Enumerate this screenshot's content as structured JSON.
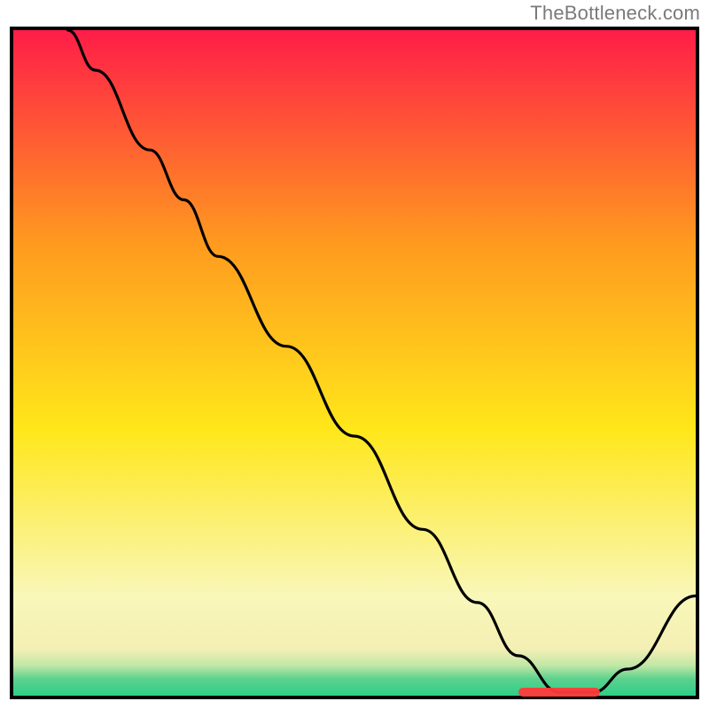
{
  "attribution": "TheBottleneck.com",
  "colors": {
    "gradient_top": "#ff1d48",
    "gradient_orange": "#ff9a1f",
    "gradient_yellow": "#ffe71a",
    "gradient_cream": "#f9f7b9",
    "gradient_low": "#f4efb4",
    "gradient_green1": "#bfe7a6",
    "gradient_green2": "#5bd18e",
    "gradient_green3": "#2ecf87",
    "border": "#000000",
    "curve": "#000000",
    "marker": "#ff3a3a"
  },
  "chart_data": {
    "type": "line",
    "title": "",
    "xlabel": "",
    "ylabel": "",
    "xlim": [
      0,
      100
    ],
    "ylim": [
      0,
      100
    ],
    "grid": false,
    "legend": false,
    "series": [
      {
        "name": "curve",
        "x": [
          8,
          12,
          20,
          25,
          30,
          40,
          50,
          60,
          68,
          74,
          80,
          85,
          90,
          100
        ],
        "y": [
          100,
          94,
          82,
          74.5,
          66,
          52.5,
          39,
          25,
          14,
          6,
          0.5,
          0.5,
          4,
          15
        ]
      }
    ],
    "optimal_region_x": [
      74,
      86
    ],
    "optimal_region_y": 0.5
  }
}
